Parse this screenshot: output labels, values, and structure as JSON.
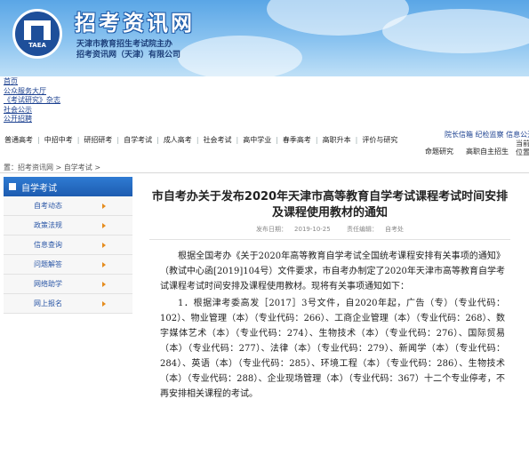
{
  "brand": {
    "title": "招考资讯网",
    "logo_text": "TAEA",
    "sub1": "天津市教育招生考试院主办",
    "sub2": "招考资讯网（天津）有限公司"
  },
  "top_links": [
    "首页",
    "公众服务大厅",
    "《考试研究》杂志",
    "社会公示",
    "公开招聘"
  ],
  "nav": [
    "普通高考",
    "中招中考",
    "研招研考",
    "自学考试",
    "成人高考",
    "社会考试",
    "高中学业",
    "春季高考",
    "高职升本",
    "评价与研究"
  ],
  "right_links": "院长信箱 纪检监察 信息公开",
  "sub_nav": [
    "命题研究",
    "高职自主招生"
  ],
  "edge": [
    "当前",
    "位置"
  ],
  "breadcrumb": {
    "prefix": "置：",
    "home": "招考资讯网",
    "sep": ">",
    "current": "自学考试",
    "sep2": ">"
  },
  "sidebar": {
    "header": "自学考试",
    "items": [
      "自考动态",
      "政策法规",
      "信息查询",
      "问题解答",
      "网络助学",
      "网上报名"
    ]
  },
  "article": {
    "title": "市自考办关于发布2020年天津市高等教育自学考试课程考试时间安排及课程使用教材的通知",
    "date_label": "发布日期：",
    "date": "2019-10-25",
    "author_label": "责任编辑：",
    "author": "自考处",
    "p1": "根据全国考办《关于2020年高等教育自学考试全国统考课程安排有关事项的通知》（教试中心函[2019]104号）文件要求，市自考办制定了2020年天津市高等教育自学考试课程考试时间安排及课程使用教材。现将有关事项通知如下：",
    "p2": "1．根据津考委高发［2017］3号文件，自2020年起，广告（专）（专业代码：102）、物业管理（本）（专业代码：266）、工商企业管理（本）（专业代码：268）、数字媒体艺术（本）（专业代码：274）、生物技术（本）（专业代码：276）、国际贸易（本）（专业代码：277）、法律（本）（专业代码：279）、新闻学（本）（专业代码：284）、英语（本）（专业代码：285）、环境工程（本）（专业代码：286）、生物技术（本）（专业代码：288）、企业现场管理（本）（专业代码：367）十二个专业停考，不再安排相关课程的考试。"
  }
}
